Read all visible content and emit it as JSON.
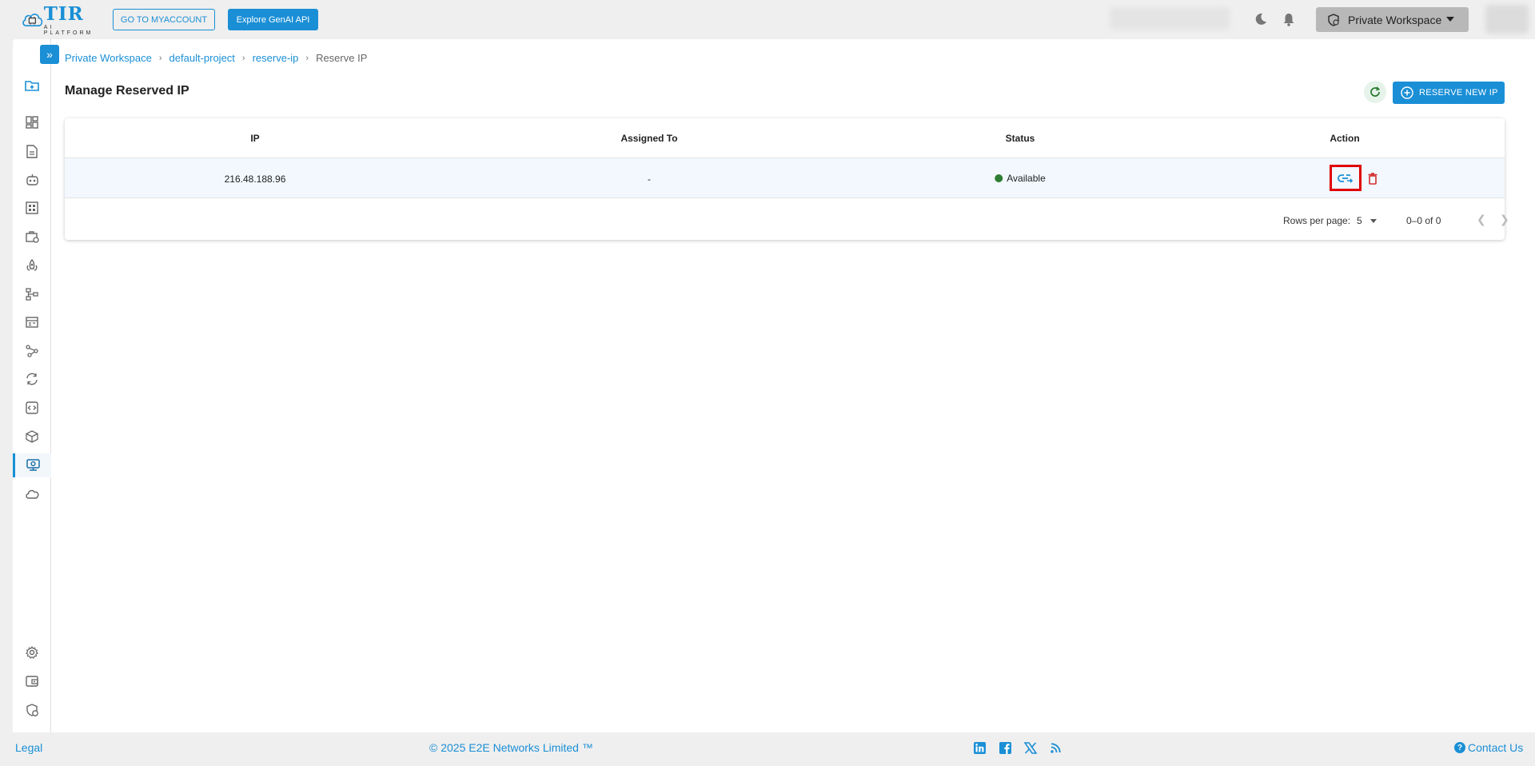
{
  "header": {
    "logo_text": "TIR",
    "logo_subtext": "AI PLATFORM",
    "myaccount_label": "GO TO MYACCOUNT",
    "genai_label": "Explore GenAI API",
    "workspace_label": "Private Workspace"
  },
  "breadcrumb": {
    "items": [
      "Private Workspace",
      "default-project",
      "reserve-ip"
    ],
    "current": "Reserve IP"
  },
  "page": {
    "title": "Manage Reserved IP",
    "reserve_button_label": "RESERVE NEW IP"
  },
  "table": {
    "columns": [
      "IP",
      "Assigned To",
      "Status",
      "Action"
    ],
    "rows": [
      {
        "ip": "216.48.188.96",
        "assigned_to": "-",
        "status": "Available"
      }
    ],
    "status_color": "#2e7d32"
  },
  "pagination": {
    "rows_per_page_label": "Rows per page:",
    "rows_per_page_value": "5",
    "range": "0–0 of 0"
  },
  "footer": {
    "legal": "Legal",
    "copyright": "© 2025 E2E Networks Limited ™",
    "contact": "Contact Us"
  },
  "colors": {
    "accent": "#1a8fd6",
    "highlight": "#e00000",
    "delete": "#d32f2f"
  },
  "sidebar_icons": [
    "folder-add-icon",
    "dashboard-icon",
    "document-icon",
    "robot-icon",
    "grid-icon",
    "briefcase-icon",
    "rocket-icon",
    "pipeline-icon",
    "table-icon",
    "share-icon",
    "sync-icon",
    "code-icon",
    "cube-icon",
    "reserved-ip-icon",
    "cloud-icon",
    "settings-icon",
    "wallet-icon",
    "shield-settings-icon"
  ]
}
